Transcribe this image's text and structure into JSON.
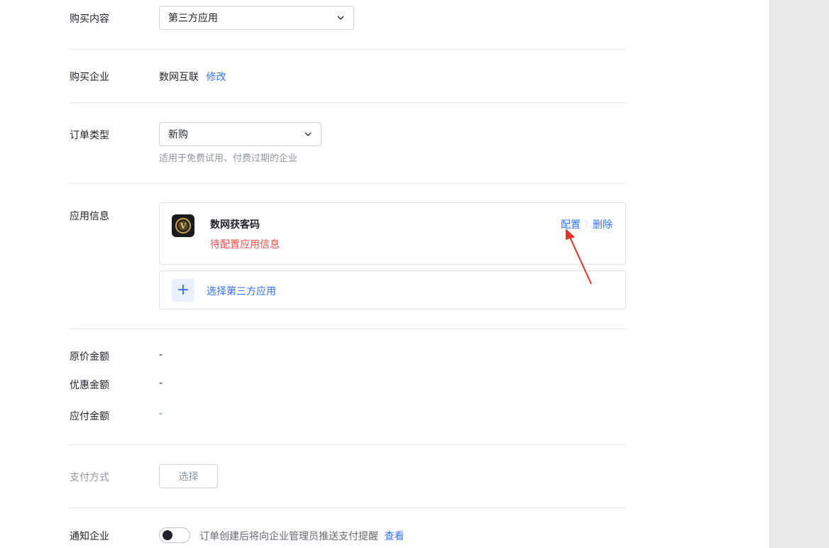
{
  "form": {
    "purchase_content": {
      "label": "购买内容",
      "value": "第三方应用"
    },
    "purchase_company": {
      "label": "购买企业",
      "value": "数网互联",
      "edit_link": "修改"
    },
    "order_type": {
      "label": "订单类型",
      "value": "新购",
      "hint": "适用于免费试用、付费过期的企业"
    },
    "app_info": {
      "label": "应用信息",
      "app": {
        "name": "数网获客码",
        "status": "待配置应用信息",
        "configure": "配置",
        "delete": "删除",
        "icon_glyph": "V"
      },
      "add_button": {
        "plus": "+",
        "label": "选择第三方应用"
      }
    },
    "original_amount": {
      "label": "原价金额",
      "value": "-"
    },
    "discount_amount": {
      "label": "优惠金额",
      "value": "-"
    },
    "payable_amount": {
      "label": "应付金额",
      "value": "-"
    },
    "payment_method": {
      "label": "支付方式",
      "button": "选择"
    },
    "notify_company": {
      "label": "通知企业",
      "text": "订单创建后将向企业管理员推送支付提醒",
      "link": "查看",
      "toggle_on": false
    }
  },
  "colors": {
    "link": "#3370ff",
    "error": "#f54a45",
    "annotation_arrow": "#e8312a"
  }
}
